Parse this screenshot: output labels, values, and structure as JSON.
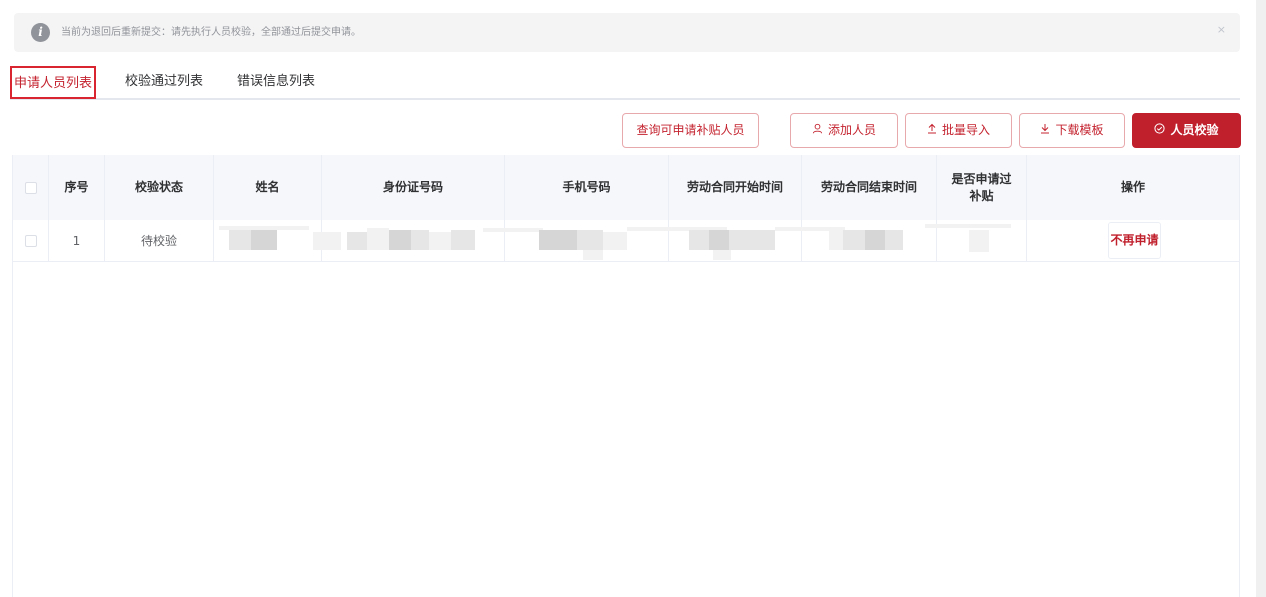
{
  "alert": {
    "icon": "info-icon",
    "text": "当前为退回后重新提交：请先执行人员校验，全部通过后提交申请。",
    "close": "×"
  },
  "tabs": [
    {
      "label": "申请人员列表",
      "active": true
    },
    {
      "label": "校验通过列表",
      "active": false
    },
    {
      "label": "错误信息列表",
      "active": false
    }
  ],
  "toolbar": {
    "query_label": "查询可申请补贴人员",
    "add_label": "添加人员",
    "add_icon": "user-icon",
    "import_label": "批量导入",
    "import_icon": "upload-icon",
    "template_label": "下载模板",
    "template_icon": "download-icon",
    "verify_label": "人员校验",
    "verify_icon": "check-circle-icon"
  },
  "table": {
    "headers": {
      "index": "序号",
      "status": "校验状态",
      "name": "姓名",
      "id_number": "身份证号码",
      "phone": "手机号码",
      "contract_start": "劳动合同开始时间",
      "contract_end": "劳动合同结束时间",
      "applied_line1": "是否申请过",
      "applied_line2": "补贴",
      "action": "操作"
    },
    "rows": [
      {
        "index": "1",
        "status": "待校验",
        "action_label": "不再申请"
      }
    ]
  },
  "colors": {
    "accent": "#c01f2c",
    "accent_border": "#e8a9ad",
    "header_bg": "#f5f7fa",
    "alert_bg": "#f4f4f5"
  }
}
